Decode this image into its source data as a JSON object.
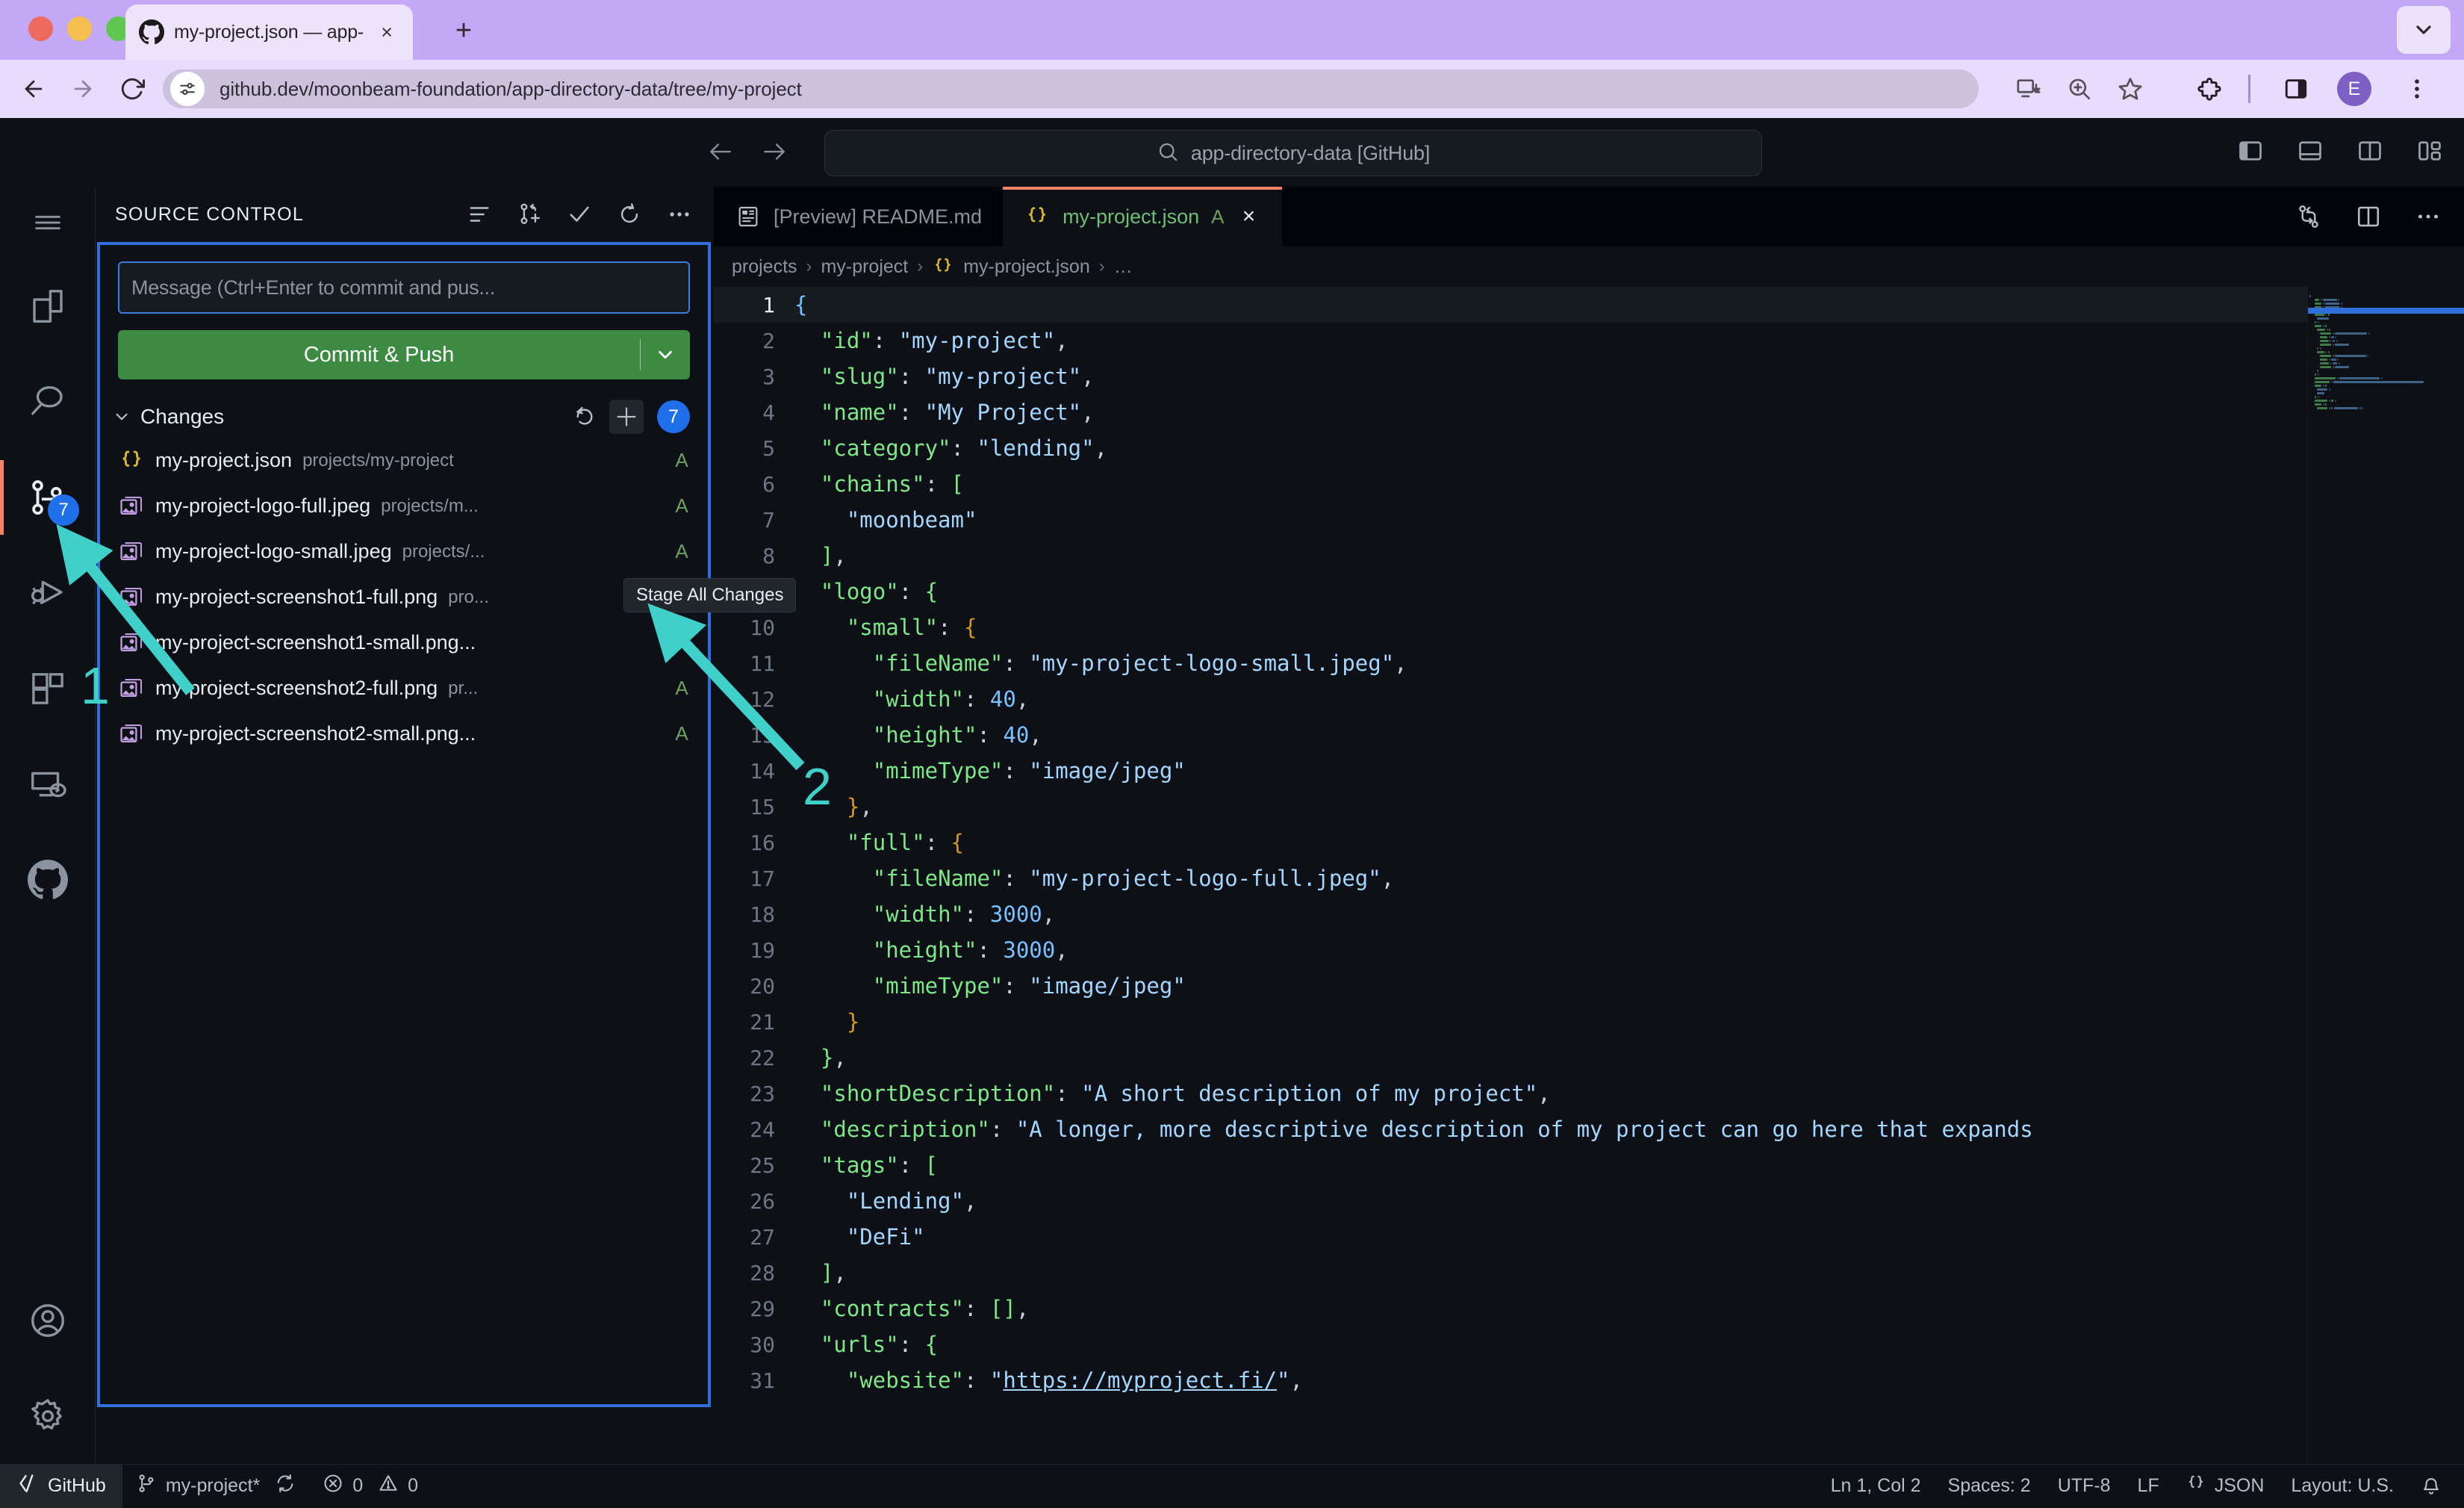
{
  "browser": {
    "tab": {
      "title": "my-project.json — app-direct",
      "favicon": "github-icon",
      "close": "×"
    },
    "new_tab": "+",
    "url": "github.dev/moonbeam-foundation/app-directory-data/tree/my-project",
    "toolbar_icons": [
      "back-icon",
      "forward-icon",
      "reload-icon",
      "site-info-icon",
      "install-app-icon",
      "zoom-icon",
      "bookmark-star-icon",
      "extensions-icon",
      "side-panel-icon",
      "profile-avatar",
      "chrome-menu-icon"
    ],
    "profile_initial": "E"
  },
  "titlebar": {
    "back": "back-icon",
    "forward": "forward-icon",
    "command_center": "app-directory-data [GitHub]",
    "search_icon": "search-icon",
    "layout_icons": [
      "toggle-primary-sidebar-icon",
      "toggle-panel-icon",
      "toggle-secondary-sidebar-icon",
      "customize-layout-icon"
    ]
  },
  "activity_bar": {
    "menu": "hamburger-menu-icon",
    "items": [
      {
        "name": "explorer",
        "icon": "files-icon",
        "badge": null,
        "active": false
      },
      {
        "name": "search",
        "icon": "search-icon",
        "badge": null,
        "active": false
      },
      {
        "name": "source-control",
        "icon": "source-control-icon",
        "badge": "7",
        "active": true
      },
      {
        "name": "run-and-debug",
        "icon": "run-debug-icon",
        "badge": null,
        "active": false
      },
      {
        "name": "extensions",
        "icon": "extensions-icon",
        "badge": null,
        "active": false
      },
      {
        "name": "remote-explorer",
        "icon": "remote-icon",
        "badge": null,
        "active": false
      },
      {
        "name": "github",
        "icon": "github-icon",
        "badge": null,
        "active": false
      }
    ],
    "bottom": [
      {
        "name": "accounts",
        "icon": "account-icon"
      },
      {
        "name": "manage",
        "icon": "gear-icon"
      }
    ]
  },
  "sidebar": {
    "title": "SOURCE CONTROL",
    "actions": [
      "view-as-tree-icon",
      "new-branch-icon",
      "commit-check-icon",
      "refresh-icon",
      "more-actions-icon"
    ],
    "commit_placeholder": "Message (Ctrl+Enter to commit and pus...",
    "commit_button": "Commit & Push",
    "commit_button_chevron": "chevron-down-icon",
    "changes": {
      "label": "Changes",
      "count": "7",
      "actions": [
        "discard-all-changes-icon",
        "stage-all-changes-icon"
      ],
      "files": [
        {
          "icon": "json-file-icon",
          "name": "my-project.json",
          "path": "projects/my-project",
          "status": "A"
        },
        {
          "icon": "image-file-icon",
          "name": "my-project-logo-full.jpeg",
          "path": "projects/m...",
          "status": "A"
        },
        {
          "icon": "image-file-icon",
          "name": "my-project-logo-small.jpeg",
          "path": "projects/...",
          "status": "A"
        },
        {
          "icon": "image-file-icon",
          "name": "my-project-screenshot1-full.png",
          "path": "pro...",
          "status": "A"
        },
        {
          "icon": "image-file-icon",
          "name": "my-project-screenshot1-small.png...",
          "path": "",
          "status": "A"
        },
        {
          "icon": "image-file-icon",
          "name": "my-project-screenshot2-full.png",
          "path": "pr...",
          "status": "A"
        },
        {
          "icon": "image-file-icon",
          "name": "my-project-screenshot2-small.png...",
          "path": "",
          "status": "A"
        }
      ]
    },
    "tooltip": "Stage All Changes"
  },
  "editor": {
    "tabs": [
      {
        "icon": "preview-md-icon",
        "label": "[Preview] README.md",
        "status": "",
        "active": false,
        "closable": false
      },
      {
        "icon": "json-file-icon",
        "label": "my-project.json",
        "status": "A",
        "active": true,
        "closable": true
      }
    ],
    "tab_close": "×",
    "actions": [
      "compare-changes-icon",
      "split-editor-icon",
      "more-actions-icon"
    ],
    "breadcrumb": [
      "projects",
      "my-project",
      "my-project.json",
      "…"
    ],
    "breadcrumb_file_icon": "json-file-icon",
    "lines": [
      {
        "n": "1",
        "tokens": [
          [
            "b1",
            "{"
          ]
        ]
      },
      {
        "n": "2",
        "tokens": [
          [
            "p",
            "  "
          ],
          [
            "k",
            "\"id\""
          ],
          [
            "p",
            ": "
          ],
          [
            "s",
            "\"my-project\""
          ],
          [
            "p",
            ","
          ]
        ]
      },
      {
        "n": "3",
        "tokens": [
          [
            "p",
            "  "
          ],
          [
            "k",
            "\"slug\""
          ],
          [
            "p",
            ": "
          ],
          [
            "s",
            "\"my-project\""
          ],
          [
            "p",
            ","
          ]
        ]
      },
      {
        "n": "4",
        "tokens": [
          [
            "p",
            "  "
          ],
          [
            "k",
            "\"name\""
          ],
          [
            "p",
            ": "
          ],
          [
            "s",
            "\"My Project\""
          ],
          [
            "p",
            ","
          ]
        ]
      },
      {
        "n": "5",
        "tokens": [
          [
            "p",
            "  "
          ],
          [
            "k",
            "\"category\""
          ],
          [
            "p",
            ": "
          ],
          [
            "s",
            "\"lending\""
          ],
          [
            "p",
            ","
          ]
        ]
      },
      {
        "n": "6",
        "tokens": [
          [
            "p",
            "  "
          ],
          [
            "k",
            "\"chains\""
          ],
          [
            "p",
            ": "
          ],
          [
            "b2",
            "["
          ]
        ]
      },
      {
        "n": "7",
        "tokens": [
          [
            "p",
            "    "
          ],
          [
            "s",
            "\"moonbeam\""
          ]
        ]
      },
      {
        "n": "8",
        "tokens": [
          [
            "p",
            "  "
          ],
          [
            "b2",
            "]"
          ],
          [
            "p",
            ","
          ]
        ]
      },
      {
        "n": "9",
        "tokens": [
          [
            "p",
            "  "
          ],
          [
            "k",
            "\"logo\""
          ],
          [
            "p",
            ": "
          ],
          [
            "b2",
            "{"
          ]
        ]
      },
      {
        "n": "10",
        "tokens": [
          [
            "p",
            "    "
          ],
          [
            "k",
            "\"small\""
          ],
          [
            "p",
            ": "
          ],
          [
            "b3",
            "{"
          ]
        ]
      },
      {
        "n": "11",
        "tokens": [
          [
            "p",
            "      "
          ],
          [
            "k",
            "\"fileName\""
          ],
          [
            "p",
            ": "
          ],
          [
            "s",
            "\"my-project-logo-small.jpeg\""
          ],
          [
            "p",
            ","
          ]
        ]
      },
      {
        "n": "12",
        "tokens": [
          [
            "p",
            "      "
          ],
          [
            "k",
            "\"width\""
          ],
          [
            "p",
            ": "
          ],
          [
            "n",
            "40"
          ],
          [
            "p",
            ","
          ]
        ]
      },
      {
        "n": "13",
        "tokens": [
          [
            "p",
            "      "
          ],
          [
            "k",
            "\"height\""
          ],
          [
            "p",
            ": "
          ],
          [
            "n",
            "40"
          ],
          [
            "p",
            ","
          ]
        ]
      },
      {
        "n": "14",
        "tokens": [
          [
            "p",
            "      "
          ],
          [
            "k",
            "\"mimeType\""
          ],
          [
            "p",
            ": "
          ],
          [
            "s",
            "\"image/jpeg\""
          ]
        ]
      },
      {
        "n": "15",
        "tokens": [
          [
            "p",
            "    "
          ],
          [
            "b3",
            "}"
          ],
          [
            "p",
            ","
          ]
        ]
      },
      {
        "n": "16",
        "tokens": [
          [
            "p",
            "    "
          ],
          [
            "k",
            "\"full\""
          ],
          [
            "p",
            ": "
          ],
          [
            "b3",
            "{"
          ]
        ]
      },
      {
        "n": "17",
        "tokens": [
          [
            "p",
            "      "
          ],
          [
            "k",
            "\"fileName\""
          ],
          [
            "p",
            ": "
          ],
          [
            "s",
            "\"my-project-logo-full.jpeg\""
          ],
          [
            "p",
            ","
          ]
        ]
      },
      {
        "n": "18",
        "tokens": [
          [
            "p",
            "      "
          ],
          [
            "k",
            "\"width\""
          ],
          [
            "p",
            ": "
          ],
          [
            "n",
            "3000"
          ],
          [
            "p",
            ","
          ]
        ]
      },
      {
        "n": "19",
        "tokens": [
          [
            "p",
            "      "
          ],
          [
            "k",
            "\"height\""
          ],
          [
            "p",
            ": "
          ],
          [
            "n",
            "3000"
          ],
          [
            "p",
            ","
          ]
        ]
      },
      {
        "n": "20",
        "tokens": [
          [
            "p",
            "      "
          ],
          [
            "k",
            "\"mimeType\""
          ],
          [
            "p",
            ": "
          ],
          [
            "s",
            "\"image/jpeg\""
          ]
        ]
      },
      {
        "n": "21",
        "tokens": [
          [
            "p",
            "    "
          ],
          [
            "b3",
            "}"
          ]
        ]
      },
      {
        "n": "22",
        "tokens": [
          [
            "p",
            "  "
          ],
          [
            "b2",
            "}"
          ],
          [
            "p",
            ","
          ]
        ]
      },
      {
        "n": "23",
        "tokens": [
          [
            "p",
            "  "
          ],
          [
            "k",
            "\"shortDescription\""
          ],
          [
            "p",
            ": "
          ],
          [
            "s",
            "\"A short description of my project\""
          ],
          [
            "p",
            ","
          ]
        ]
      },
      {
        "n": "24",
        "tokens": [
          [
            "p",
            "  "
          ],
          [
            "k",
            "\"description\""
          ],
          [
            "p",
            ": "
          ],
          [
            "s",
            "\"A longer, more descriptive description of my project can go here that expands"
          ]
        ]
      },
      {
        "n": "25",
        "tokens": [
          [
            "p",
            "  "
          ],
          [
            "k",
            "\"tags\""
          ],
          [
            "p",
            ": "
          ],
          [
            "b2",
            "["
          ]
        ]
      },
      {
        "n": "26",
        "tokens": [
          [
            "p",
            "    "
          ],
          [
            "s",
            "\"Lending\""
          ],
          [
            "p",
            ","
          ]
        ]
      },
      {
        "n": "27",
        "tokens": [
          [
            "p",
            "    "
          ],
          [
            "s",
            "\"DeFi\""
          ]
        ]
      },
      {
        "n": "28",
        "tokens": [
          [
            "p",
            "  "
          ],
          [
            "b2",
            "]"
          ],
          [
            "p",
            ","
          ]
        ]
      },
      {
        "n": "29",
        "tokens": [
          [
            "p",
            "  "
          ],
          [
            "k",
            "\"contracts\""
          ],
          [
            "p",
            ": "
          ],
          [
            "b2",
            "[]"
          ],
          [
            "p",
            ","
          ]
        ]
      },
      {
        "n": "30",
        "tokens": [
          [
            "p",
            "  "
          ],
          [
            "k",
            "\"urls\""
          ],
          [
            "p",
            ": "
          ],
          [
            "b2",
            "{"
          ]
        ]
      },
      {
        "n": "31",
        "tokens": [
          [
            "p",
            "    "
          ],
          [
            "k",
            "\"website\""
          ],
          [
            "p",
            ": "
          ],
          [
            "s",
            "\""
          ],
          [
            "lnk",
            "https://myproject.fi/"
          ],
          [
            "s",
            "\""
          ],
          [
            "p",
            ","
          ]
        ]
      }
    ]
  },
  "statusbar": {
    "remote": "GitHub",
    "remote_icon": "remote-indicator-icon",
    "branch_icon": "git-branch-icon",
    "branch": "my-project*",
    "sync_icon": "sync-icon",
    "error_icon": "error-icon",
    "errors": "0",
    "warning_icon": "warning-icon",
    "warnings": "0",
    "cursor": "Ln 1, Col 2",
    "indent": "Spaces: 2",
    "encoding": "UTF-8",
    "eol": "LF",
    "language_icon": "json-file-icon",
    "language": "JSON",
    "layout": "Layout: U.S.",
    "bell_icon": "bell-icon"
  },
  "annotations": [
    {
      "number": "1",
      "target": "source-control-activity-icon",
      "color": "#3fd0c9"
    },
    {
      "number": "2",
      "target": "stage-all-changes-button",
      "color": "#3fd0c9"
    }
  ]
}
